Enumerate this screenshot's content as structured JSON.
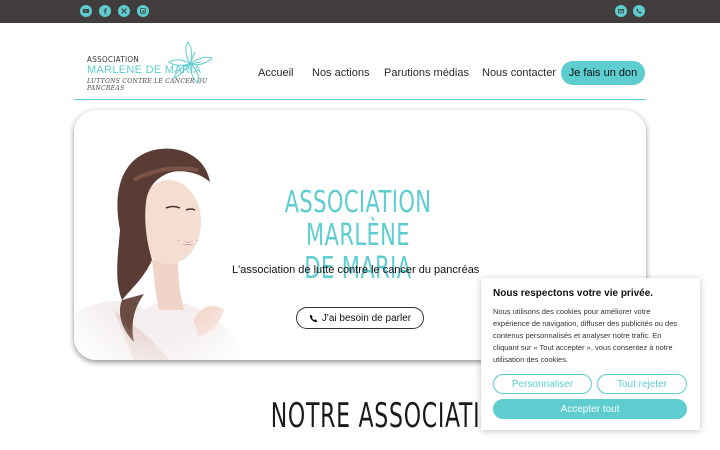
{
  "colors": {
    "accent": "#5dcdd0",
    "topbar": "#403d3c",
    "text": "#1a1a1a"
  },
  "topbar": {
    "social_icons": [
      "youtube-icon",
      "facebook-icon",
      "x-icon",
      "linkedin-icon"
    ],
    "contact_icons": [
      "mail-icon",
      "phone-icon"
    ]
  },
  "logo": {
    "line1": "ASSOCIATION",
    "line2": "MARLENE DE MARIA",
    "line3": "LUTTONS CONTRE LE CANCER DU PANCREAS"
  },
  "nav": {
    "items": [
      "Accueil",
      "Nos actions",
      "Parutions médias",
      "Nous contacter"
    ],
    "donate": "Je fais un don"
  },
  "hero": {
    "title_line1": "ASSOCIATION MARLÈNE",
    "title_line2": "DE MARIA",
    "subtitle": "L'association de lutte contre le cancer du pancréas",
    "button": "J'ai besoin de parler"
  },
  "section": {
    "title": "NOTRE ASSOCIATION"
  },
  "cookie": {
    "title": "Nous respectons votre vie privée.",
    "text": "Nous utilisons des cookies pour améliorer votre expérience de navigation, diffuser des publicités ou des contenus personnalisés et analyser notre trafic. En cliquant sur « Tout accepter », vous consentez à notre utilisation des cookies.",
    "customize": "Personnaliser",
    "reject": "Tout rejeter",
    "accept": "Accepter tout"
  }
}
